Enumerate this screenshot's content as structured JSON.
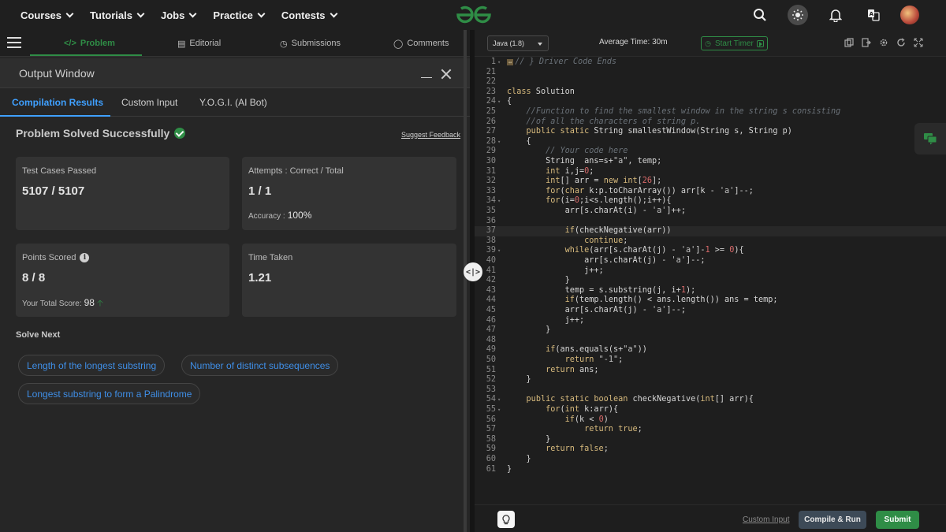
{
  "topnav": {
    "items": [
      "Courses",
      "Tutorials",
      "Jobs",
      "Practice",
      "Contests"
    ]
  },
  "problem_tabs": {
    "problem": "Problem",
    "editorial": "Editorial",
    "submissions": "Submissions",
    "comments": "Comments"
  },
  "output_window": {
    "title": "Output Window",
    "tabs": [
      "Compilation Results",
      "Custom Input",
      "Y.O.G.I. (AI Bot)"
    ],
    "status": "Problem Solved Successfully",
    "feedback_link": "Suggest Feedback",
    "cards": {
      "test_cases": {
        "label": "Test Cases Passed",
        "value": "5107 / 5107"
      },
      "attempts": {
        "label": "Attempts : Correct / Total",
        "value": "1 / 1",
        "sub_label": "Accuracy :",
        "sub_value": "100%"
      },
      "points": {
        "label": "Points Scored",
        "value": "8 / 8",
        "sub_label": "Your Total Score:",
        "sub_value": "98"
      },
      "time": {
        "label": "Time Taken",
        "value": "1.21"
      }
    },
    "solve_next": {
      "heading": "Solve Next",
      "items": [
        "Length of the longest substring",
        "Number of distinct subsequences",
        "Longest substring to form a Palindrome"
      ]
    }
  },
  "editor": {
    "language": "Java (1.8)",
    "average_time": "Average Time: 30m",
    "timer_label": "Start Timer",
    "custom_input_link": "Custom Input",
    "compile_run_label": "Compile & Run",
    "submit_label": "Submit",
    "lines": [
      {
        "n": "1",
        "fold": true,
        "marker": true,
        "html": "<span class='cm'>// } Driver Code Ends</span>"
      },
      {
        "n": "21",
        "html": ""
      },
      {
        "n": "22",
        "html": ""
      },
      {
        "n": "23",
        "html": "<span class='kw'>class</span> Solution"
      },
      {
        "n": "24",
        "fold": true,
        "html": "{"
      },
      {
        "n": "25",
        "html": "    <span class='cm'>//Function to find the smallest window in the string s consisting</span>"
      },
      {
        "n": "26",
        "html": "    <span class='cm'>//of all the characters of string p.</span>"
      },
      {
        "n": "27",
        "html": "    <span class='kw'>public static</span> String smallestWindow(String s, String p)"
      },
      {
        "n": "28",
        "fold": true,
        "html": "    {"
      },
      {
        "n": "29",
        "html": "        <span class='cm'>// Your code here</span>"
      },
      {
        "n": "30",
        "html": "        String  ans=s+<span class='st'>\"a\"</span>, temp;"
      },
      {
        "n": "31",
        "html": "        <span class='kw'>int</span> i,j=<span class='nm'>0</span>;"
      },
      {
        "n": "32",
        "html": "        <span class='kw'>int</span>[] arr = <span class='kw'>new int</span>[<span class='nm'>26</span>];"
      },
      {
        "n": "33",
        "html": "        <span class='kw'>for</span>(<span class='kw'>char</span> k:p.toCharArray()) arr[k - <span class='st'>'a'</span>]--;"
      },
      {
        "n": "34",
        "fold": true,
        "html": "        <span class='kw'>for</span>(i=<span class='nm'>0</span>;i&lt;s.length();i++){"
      },
      {
        "n": "35",
        "html": "            arr[s.charAt(i) - <span class='st'>'a'</span>]++;"
      },
      {
        "n": "36",
        "html": ""
      },
      {
        "n": "37",
        "cur": true,
        "html": "            <span class='kw'>if</span>(checkNegative(arr))"
      },
      {
        "n": "38",
        "html": "                <span class='kw'>continue</span>;"
      },
      {
        "n": "39",
        "fold": true,
        "html": "            <span class='kw'>while</span>(arr[s.charAt(j) - <span class='st'>'a'</span>]-<span class='nm'>1</span> &gt;= <span class='nm'>0</span>){"
      },
      {
        "n": "40",
        "html": "                arr[s.charAt(j) - <span class='st'>'a'</span>]--;"
      },
      {
        "n": "41",
        "html": "                j++;"
      },
      {
        "n": "42",
        "html": "            }"
      },
      {
        "n": "43",
        "html": "            temp = s.substring(j, i+<span class='nm'>1</span>);"
      },
      {
        "n": "44",
        "html": "            <span class='kw'>if</span>(temp.length() &lt; ans.length()) ans = temp;"
      },
      {
        "n": "45",
        "html": "            arr[s.charAt(j) - <span class='st'>'a'</span>]--;"
      },
      {
        "n": "46",
        "html": "            j++;"
      },
      {
        "n": "47",
        "html": "        }"
      },
      {
        "n": "48",
        "html": ""
      },
      {
        "n": "49",
        "html": "        <span class='kw'>if</span>(ans.equals(s+<span class='st'>\"a\"</span>))"
      },
      {
        "n": "50",
        "html": "            <span class='kw'>return</span> <span class='st'>\"-1\"</span>;"
      },
      {
        "n": "51",
        "html": "        <span class='kw'>return</span> ans;"
      },
      {
        "n": "52",
        "html": "    }"
      },
      {
        "n": "53",
        "html": ""
      },
      {
        "n": "54",
        "fold": true,
        "html": "    <span class='kw'>public static boolean</span> checkNegative(<span class='kw'>int</span>[] arr){"
      },
      {
        "n": "55",
        "fold": true,
        "html": "        <span class='kw'>for</span>(<span class='kw'>int</span> k:arr){"
      },
      {
        "n": "56",
        "html": "            <span class='kw'>if</span>(k &lt; <span class='nm'>0</span>)"
      },
      {
        "n": "57",
        "html": "                <span class='kw'>return true</span>;"
      },
      {
        "n": "58",
        "html": "        }"
      },
      {
        "n": "59",
        "html": "        <span class='kw'>return false</span>;"
      },
      {
        "n": "60",
        "html": "    }"
      },
      {
        "n": "61",
        "html": "}"
      }
    ]
  },
  "colors": {
    "accent_green": "#2f8d46",
    "link_blue": "#3fa0ff",
    "background": "#1e1e1e"
  }
}
